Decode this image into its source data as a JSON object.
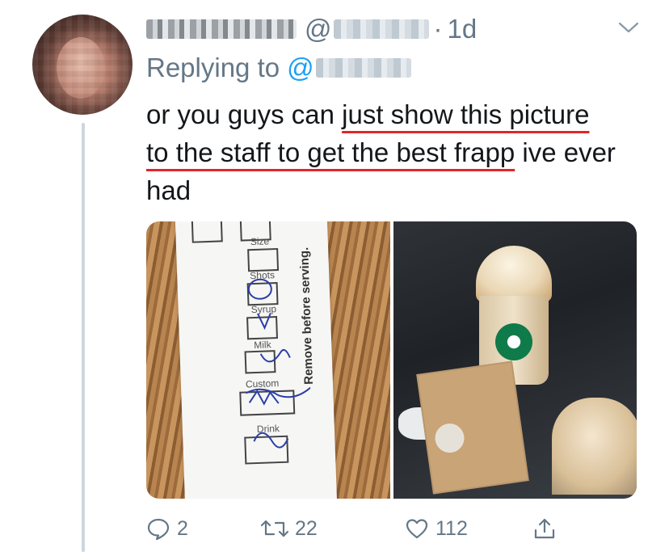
{
  "tweet": {
    "at_symbol": "@",
    "separator": "·",
    "timestamp": "1d",
    "replying_prefix": "Replying to",
    "replying_at": "@",
    "text_segments": [
      {
        "text": "or you guys can ",
        "underlined": false
      },
      {
        "text": "just show this picture",
        "underlined": true
      },
      {
        "text": " ",
        "underlined": false
      },
      {
        "text": "to the staff to get the best frapp",
        "underlined": true
      },
      {
        "text": " ive ever had",
        "underlined": false
      }
    ]
  },
  "media": {
    "left_image": {
      "labels": {
        "size": "Size",
        "shots": "Shots",
        "syrup": "Syrup",
        "milk": "Milk",
        "custom": "Custom",
        "drink": "Drink",
        "remove": "Remove before serving."
      }
    },
    "right_image": {}
  },
  "actions": {
    "replies": "2",
    "retweets": "22",
    "likes": "112"
  },
  "colors": {
    "link": "#1da1f2",
    "muted": "#657786",
    "underline": "#e0262b"
  }
}
